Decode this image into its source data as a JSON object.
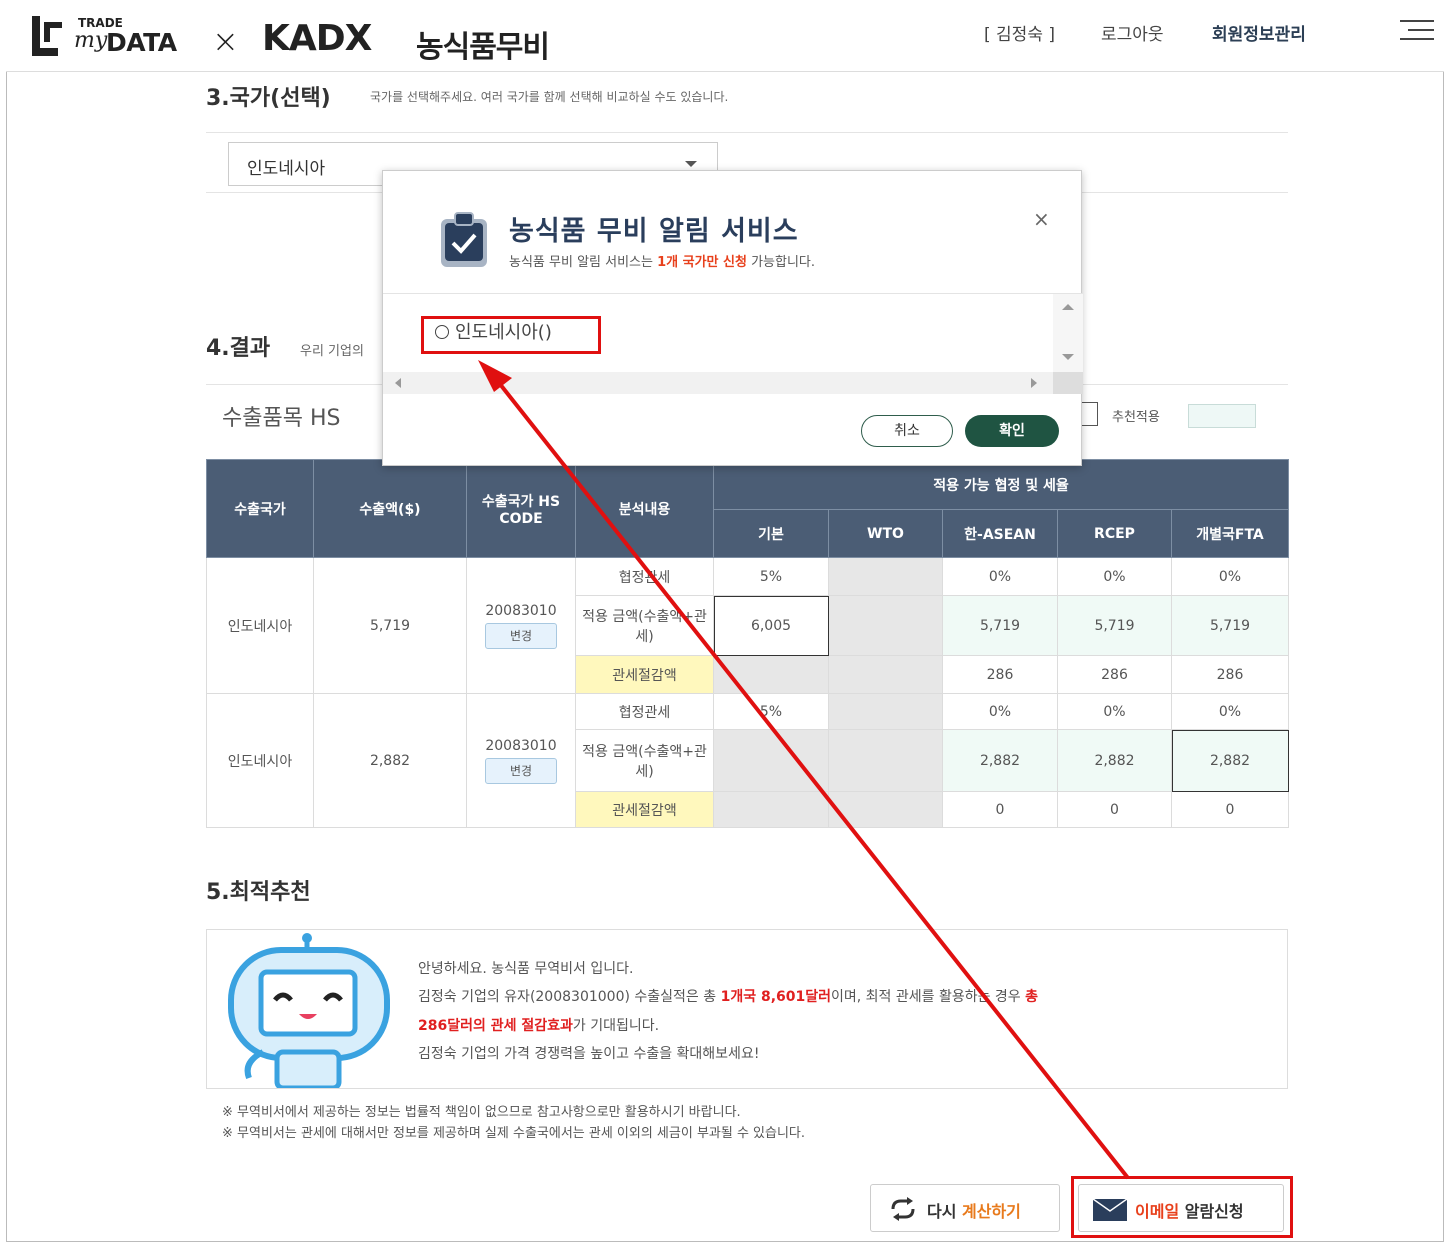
{
  "header": {
    "logo_trade": "TRADE",
    "logo_my": "my",
    "logo_data": "DATA",
    "logo_x": "×",
    "logo_kadx": "KADX",
    "logo_kr": "농식품무비",
    "user": "[ 김정숙 ]",
    "logout": "로그아웃",
    "member": "회원정보관리"
  },
  "section3": {
    "title": "3.국가(선택)",
    "desc": "국가를 선택해주세요. 여러 국가를 함께 선택해 비교하실 수도 있습니다.",
    "selected_country": "인도네시아"
  },
  "section4": {
    "title": "4.결과",
    "desc": "우리 기업의",
    "hs_label": "수출품목 HS",
    "recommend_label": "추천적용"
  },
  "table": {
    "headers": {
      "country": "수출국가",
      "amount": "수출액($)",
      "hs_code": "수출국가 HS CODE",
      "analysis": "분석내용",
      "agreements": "적용 가능 협정 및 세율",
      "basic": "기본",
      "wto": "WTO",
      "asean": "한-ASEAN",
      "rcep": "RCEP",
      "fta": "개별국FTA"
    },
    "change_label": "변경",
    "blocks": [
      {
        "country": "인도네시아",
        "amount": "5,719",
        "hs": "20083010",
        "rows": [
          {
            "label": "협정관세",
            "basic": "5%",
            "wto": "",
            "asean": "0%",
            "rcep": "0%",
            "fta": "0%"
          },
          {
            "label": "적용 금액(수출액+관세)",
            "basic": "6,005",
            "wto": "",
            "asean": "5,719",
            "rcep": "5,719",
            "fta": "5,719"
          },
          {
            "label": "관세절감액",
            "basic": "",
            "wto": "",
            "asean": "286",
            "rcep": "286",
            "fta": "286"
          }
        ]
      },
      {
        "country": "인도네시아",
        "amount": "2,882",
        "hs": "20083010",
        "rows": [
          {
            "label": "협정관세",
            "basic": "5%",
            "wto": "",
            "asean": "0%",
            "rcep": "0%",
            "fta": "0%"
          },
          {
            "label": "적용 금액(수출액+관세)",
            "basic": "",
            "wto": "",
            "asean": "2,882",
            "rcep": "2,882",
            "fta": "2,882"
          },
          {
            "label": "관세절감액",
            "basic": "",
            "wto": "",
            "asean": "0",
            "rcep": "0",
            "fta": "0"
          }
        ]
      }
    ]
  },
  "section5": {
    "title": "5.최적추천",
    "line1": "안녕하세요. 농식품 무역비서 입니다.",
    "line2_a": "김정숙 기업의 유자(2008301000) 수출실적은 총 ",
    "line2_red": "1개국 8,601달러",
    "line2_b": "이며, 최적 관세를 활용하는 경우 ",
    "line2_red2": "총",
    "line3_red": "286달러의 관세 절감효과",
    "line3_b": "가 기대됩니다.",
    "line4": "김정숙 기업의 가격 경쟁력을 높이고 수출을 확대해보세요!",
    "note1": "※ 무역비서에서 제공하는 정보는 법률적 책임이 없으므로 참고사항으로만 활용하시기 바랍니다.",
    "note2": "※ 무역비서는 관세에 대해서만 정보를 제공하며 실제 수출국에서는 관세 이외의 세금이 부과될 수 있습니다."
  },
  "buttons": {
    "recalc_a": "다시 ",
    "recalc_b": "계산하기",
    "email_a": "이메일",
    "email_b": " 알람신청"
  },
  "modal": {
    "title": "농식품 무비 알림 서비스",
    "sub_a": "농식품 무비 알림 서비스는 ",
    "sub_red": "1개 국가만 신청",
    "sub_b": " 가능합니다.",
    "close": "×",
    "option": "인도네시아()",
    "cancel": "취소",
    "ok": "확인"
  },
  "colors": {
    "header_bg": "#4b5d75",
    "accent_red": "#e01010",
    "ok_green": "#1f5442",
    "mint": "#f0faf6",
    "yellow": "#fff8bd"
  }
}
